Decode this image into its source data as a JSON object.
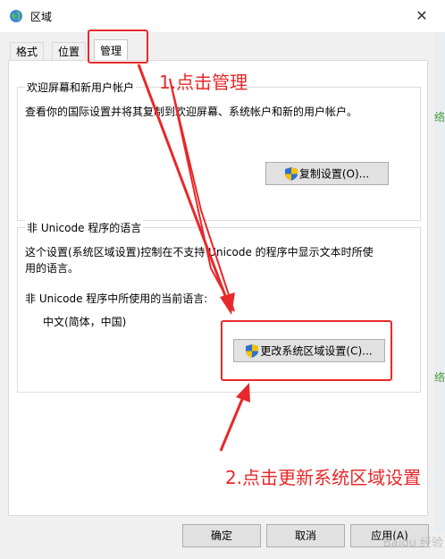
{
  "window": {
    "title": "区域",
    "close": "✕"
  },
  "tabs": [
    {
      "label": "格式"
    },
    {
      "label": "位置"
    },
    {
      "label": "管理"
    }
  ],
  "welcome": {
    "title": "欢迎屏幕和新用户帐户",
    "description": "查看你的国际设置并将其复制到欢迎屏幕、系统帐户和新的用户帐户。",
    "copy_button": "复制设置(O)..."
  },
  "nonunicode": {
    "title": "非 Unicode 程序的语言",
    "description_line1": "这个设置(系统区域设置)控制在不支持 Unicode 的程序中显示文本时所使",
    "description_line2": "用的语言。",
    "current_label": "非 Unicode 程序中所使用的当前语言:",
    "current_value": "中文(简体，中国)",
    "change_button": "更改系统区域设置(C)..."
  },
  "annotations": {
    "step1": "1.点击管理",
    "step2": "2.点击更新系统区域设置"
  },
  "footer": {
    "ok": "确定",
    "cancel": "取消",
    "apply": "应用(A)"
  },
  "edge_glyph": "络",
  "watermark": "Baidu 经验",
  "colors": {
    "annotation": "#e8282a",
    "shield_blue": "#2f6fd1",
    "shield_yellow": "#f2c200"
  }
}
